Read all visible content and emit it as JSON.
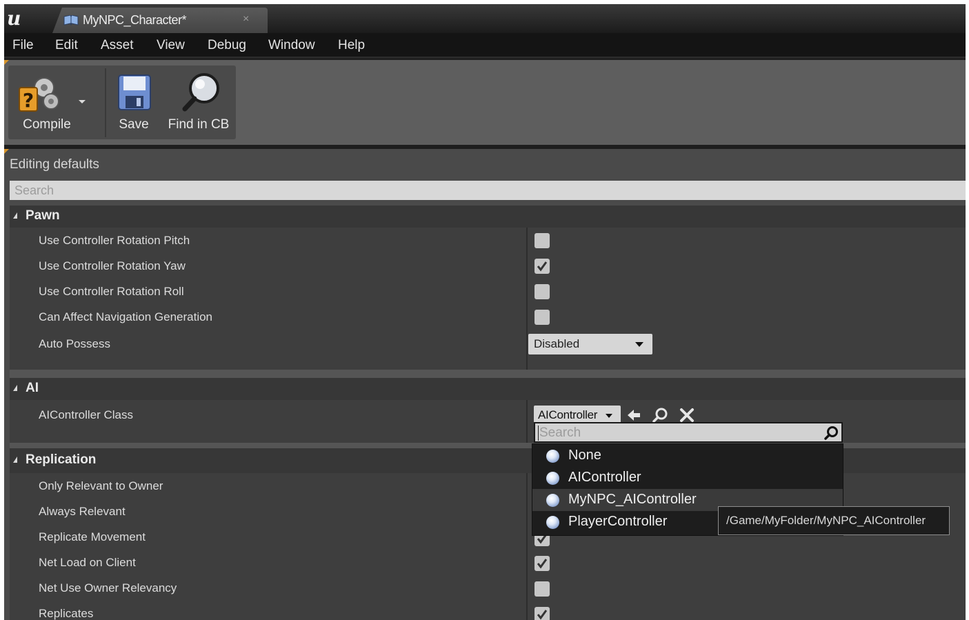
{
  "app": {
    "logo_text": "u",
    "tab_title": "MyNPC_Character*",
    "tab_close": "×"
  },
  "menu": {
    "items": [
      "File",
      "Edit",
      "Asset",
      "View",
      "Debug",
      "Window",
      "Help"
    ]
  },
  "toolbar": {
    "compile_label": "Compile",
    "save_label": "Save",
    "find_label": "Find in CB"
  },
  "details": {
    "title": "Editing defaults",
    "search_placeholder": "Search",
    "categories": {
      "pawn": {
        "title": "Pawn",
        "props": [
          {
            "label": "Use Controller Rotation Pitch",
            "checked": false
          },
          {
            "label": "Use Controller Rotation Yaw",
            "checked": true
          },
          {
            "label": "Use Controller Rotation Roll",
            "checked": false
          },
          {
            "label": "Can Affect Navigation Generation",
            "checked": false
          }
        ],
        "auto_possess_label": "Auto Possess",
        "auto_possess_value": "Disabled"
      },
      "ai": {
        "title": "AI",
        "class_label": "AIController Class",
        "class_value": "AIController"
      },
      "replication": {
        "title": "Replication",
        "props": [
          {
            "label": "Only Relevant to Owner",
            "checked": false
          },
          {
            "label": "Always Relevant",
            "checked": false
          },
          {
            "label": "Replicate Movement",
            "checked": true
          },
          {
            "label": "Net Load on Client",
            "checked": true
          },
          {
            "label": "Net Use Owner Relevancy",
            "checked": false
          },
          {
            "label": "Replicates",
            "checked": true
          }
        ]
      }
    }
  },
  "picker": {
    "search_placeholder": "Search",
    "items": [
      "None",
      "AIController",
      "MyNPC_AIController",
      "PlayerController"
    ],
    "hovered_item": "MyNPC_AIController"
  },
  "tooltip": {
    "text": "/Game/MyFolder/MyNPC_AIController"
  },
  "colors": {
    "accent_orange": "#d9962b",
    "panel_bg": "#3e3e3e",
    "header_bg": "#373737"
  }
}
